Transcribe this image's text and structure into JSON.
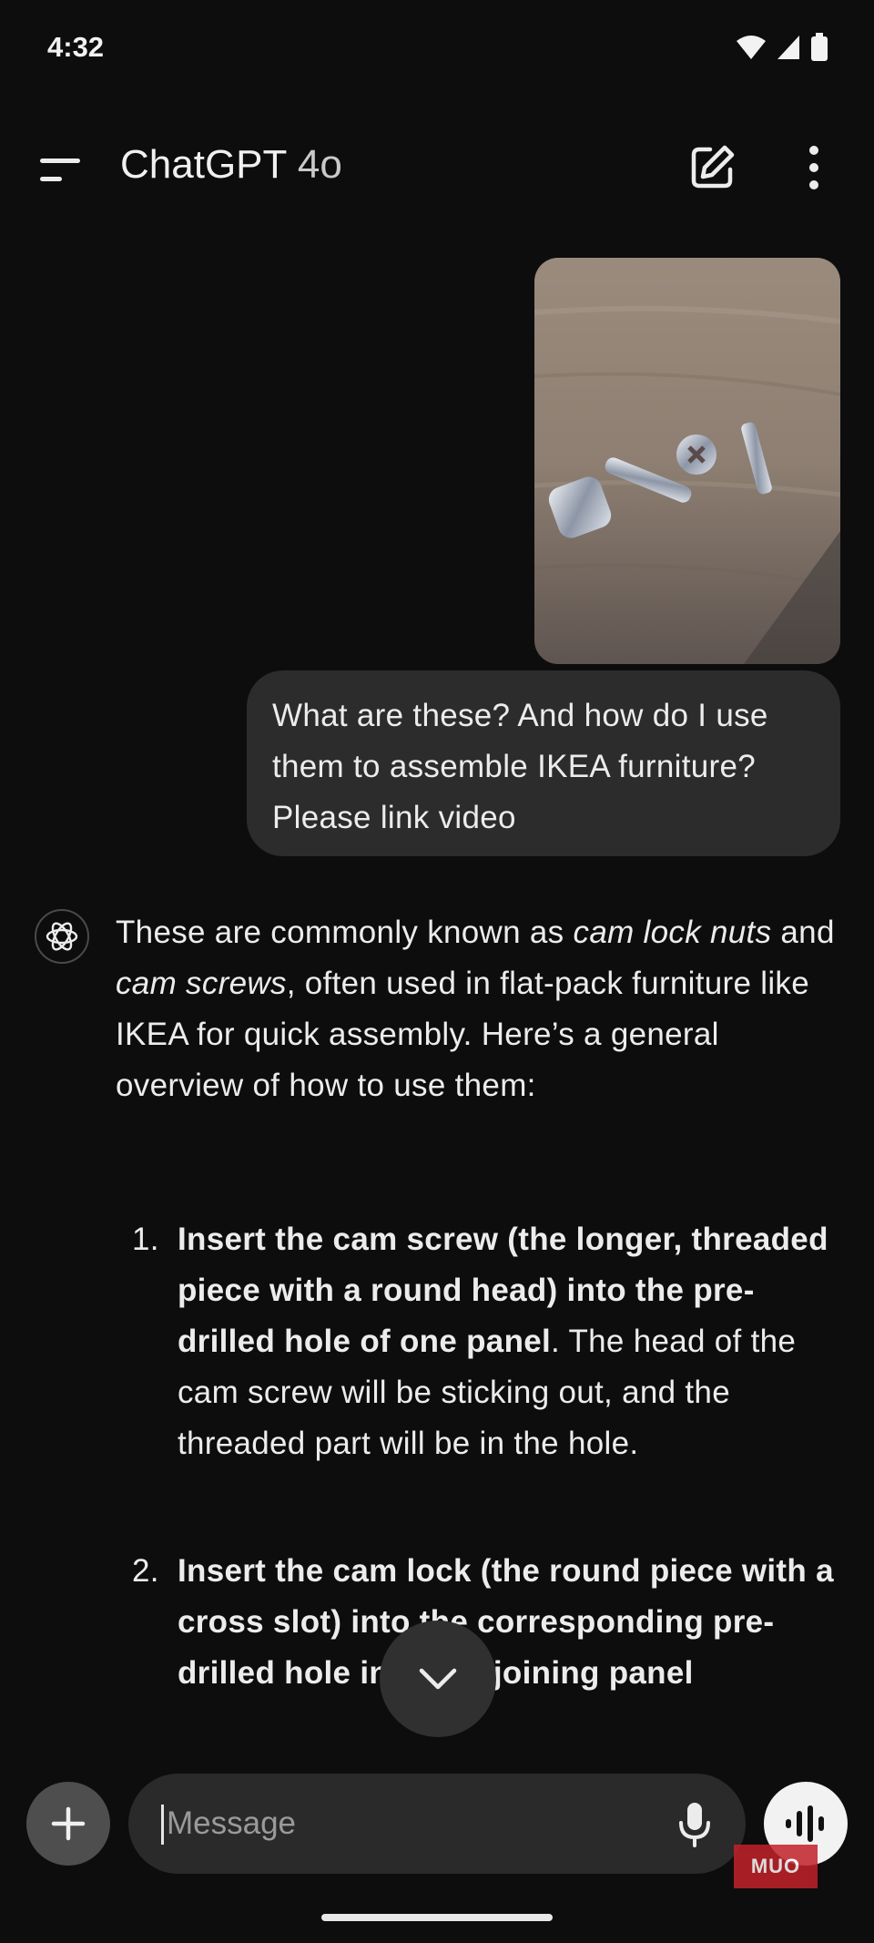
{
  "status_bar": {
    "time": "4:32"
  },
  "header": {
    "title": "ChatGPT",
    "model": "4o"
  },
  "conversation": {
    "user_message": "What are these? And how do I use them to assemble IKEA furniture? Please link video",
    "assistant": {
      "intro": {
        "p1": "These are commonly known as ",
        "em1": "cam lock nuts",
        "p2": " and ",
        "em2": "cam screws",
        "p3": ", often used in flat-pack furniture like IKEA for quick assembly. Here’s a general overview of how to use them:"
      },
      "steps": [
        {
          "number": "1.",
          "bold": "Insert the cam screw (the longer, threaded piece with a round head) into the pre-drilled hole of one panel",
          "text": ". The head of the cam screw will be sticking out, and the threaded part will be in the hole."
        },
        {
          "number": "2.",
          "bold": "Insert the cam lock (the round piece with a cross slot) into the corresponding pre-drilled hole in the adjoining panel",
          "text": ""
        }
      ]
    }
  },
  "composer": {
    "placeholder": "Message"
  },
  "watermark": "MUO",
  "icons": [
    "menu-icon",
    "edit-icon",
    "more-vertical-icon",
    "chatgpt-logo-icon",
    "chevron-down-icon",
    "plus-icon",
    "mic-icon",
    "voice-wave-icon",
    "wifi-icon",
    "signal-icon",
    "battery-icon"
  ]
}
